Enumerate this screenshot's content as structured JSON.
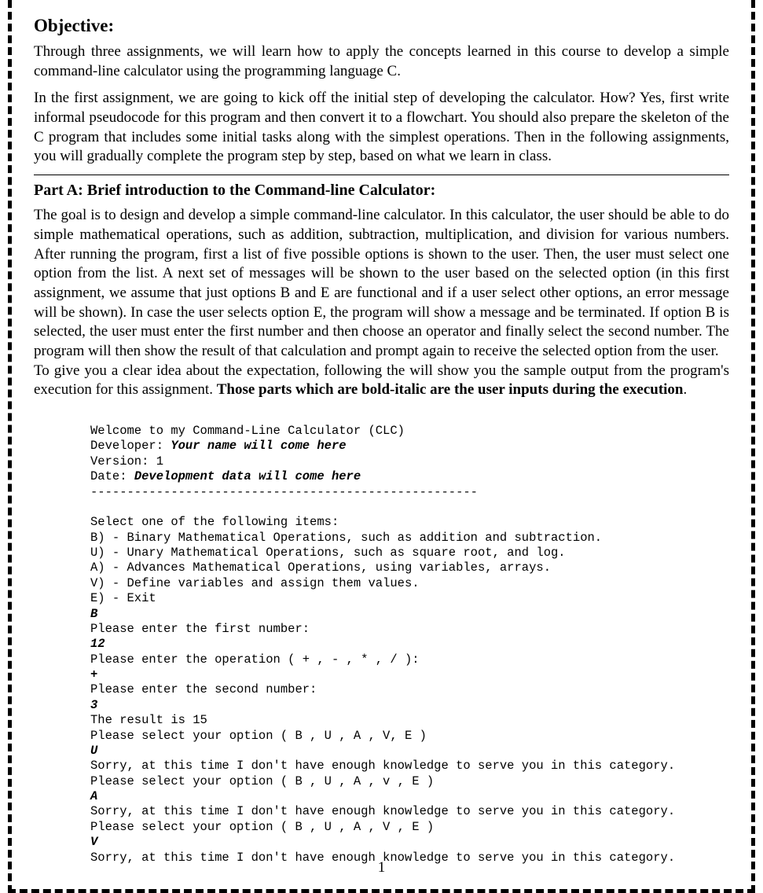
{
  "sections": {
    "objective_heading": "Objective:",
    "objective_p1": "Through three assignments, we will learn how to apply the concepts learned in this course to develop a simple command-line calculator using the programming language C.",
    "objective_p2": "In the first assignment, we are going to kick off the initial step of developing the calculator. How? Yes, first write informal pseudocode for this program and then convert it to a flowchart. You should also prepare the skeleton of the C program that includes some initial tasks along with the simplest operations. Then in the following assignments, you will gradually complete the program step by step, based on what we learn in class.",
    "partA_heading": "Part A: Brief introduction to the Command-line Calculator:",
    "partA_p1": "The goal is to design and develop a simple command-line calculator. In this calculator, the user should be able to do simple mathematical operations, such as addition, subtraction, multiplication, and division for various numbers. After running the program, first a list of five possible options is shown to the user. Then, the user must select one option from the list. A next set of messages will be shown to the user based on the selected option (in this first assignment, we assume that just options B and E are functional and if a user select other options, an error message will be shown). In case the user selects option E, the program will show a message and be terminated. If option B is selected, the user must enter the first number and then choose an operator and finally select the second number. The program will then show the result of that calculation and prompt again to receive the selected option from the user.",
    "partA_p2a": "To give you a clear idea about the expectation, following the will show you the sample output from the program's execution for this assignment. ",
    "partA_p2b_bold": "Those parts which are bold-italic are the user inputs during the execution",
    "partA_p2c": "."
  },
  "code": {
    "welcome": "Welcome to my Command-Line Calculator (CLC)",
    "developer_label": "Developer: ",
    "developer_value": "Your name will come here",
    "version": "Version: 1",
    "date_label": "Date: ",
    "date_value": "Development data will come here",
    "divider": "-----------------------------------------------------",
    "blank": "",
    "select_header": "Select one of the following items:",
    "option_B": "B) - Binary Mathematical Operations, such as addition and subtraction.",
    "option_U": "U) - Unary Mathematical Operations, such as square root, and log.",
    "option_A": "A) - Advances Mathematical Operations, using variables, arrays.",
    "option_V": "V) - Define variables and assign them values.",
    "option_E": "E) - Exit",
    "input_B": "B",
    "prompt_first": "Please enter the first number:",
    "input_12": "12",
    "prompt_op": "Please enter the operation ( + , - , * , / ):",
    "input_plus": "+",
    "prompt_second": "Please enter the second number:",
    "input_3": "3",
    "result": "The result is 15",
    "prompt_select1": "Please select your option ( B , U , A , V, E )",
    "input_U": "U",
    "sorry": "Sorry, at this time I don't have enough knowledge to serve you in this category.",
    "prompt_select2": "Please select your option ( B , U , A , v , E )",
    "input_A": "A",
    "prompt_select3": "Please select your option ( B , U , A , V , E )",
    "input_V": "V"
  },
  "page_number": "1"
}
